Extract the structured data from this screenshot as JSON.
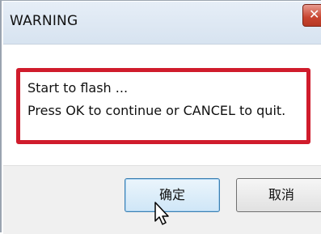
{
  "window": {
    "title": "WARNING",
    "close_glyph": "✕"
  },
  "message": {
    "line1": "Start to flash ...",
    "line2": "Press OK to continue or CANCEL to quit."
  },
  "buttons": {
    "ok_label": "确定",
    "cancel_label": "取消"
  },
  "colors": {
    "highlight_border": "#d01c2c",
    "close_button": "#c8442f"
  }
}
